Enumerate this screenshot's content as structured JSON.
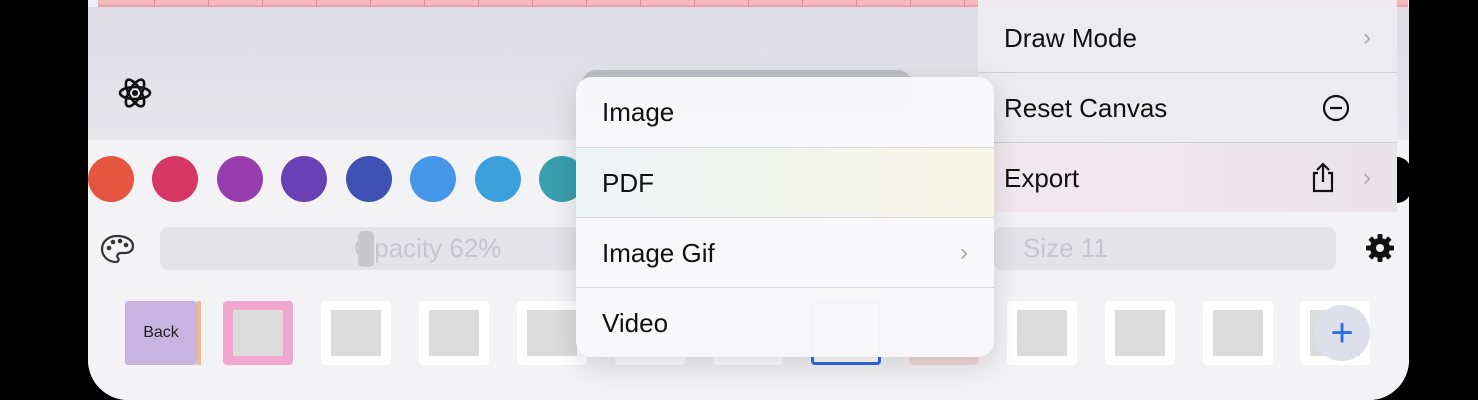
{
  "toolbar": {
    "opacity_label": "Opacity 62%",
    "size_label": "Size 11",
    "back_label": "Back",
    "add_label": "+"
  },
  "swatches": [
    "#e65540",
    "#d63766",
    "#973cae",
    "#6741b5",
    "#4051b4",
    "#4596e8",
    "#3ca0dd",
    "#3a9fae"
  ],
  "context_menu": {
    "items": [
      {
        "label": "Draw Mode",
        "icon": "chevron-right-icon"
      },
      {
        "label": "Reset Canvas",
        "icon": "minus-circle-icon"
      },
      {
        "label": "Export",
        "icon": "share-icon"
      }
    ]
  },
  "export_menu": {
    "items": [
      {
        "label": "Image"
      },
      {
        "label": "PDF"
      },
      {
        "label": "Image Gif",
        "icon": "chevron-right-icon"
      },
      {
        "label": "Video"
      }
    ]
  }
}
